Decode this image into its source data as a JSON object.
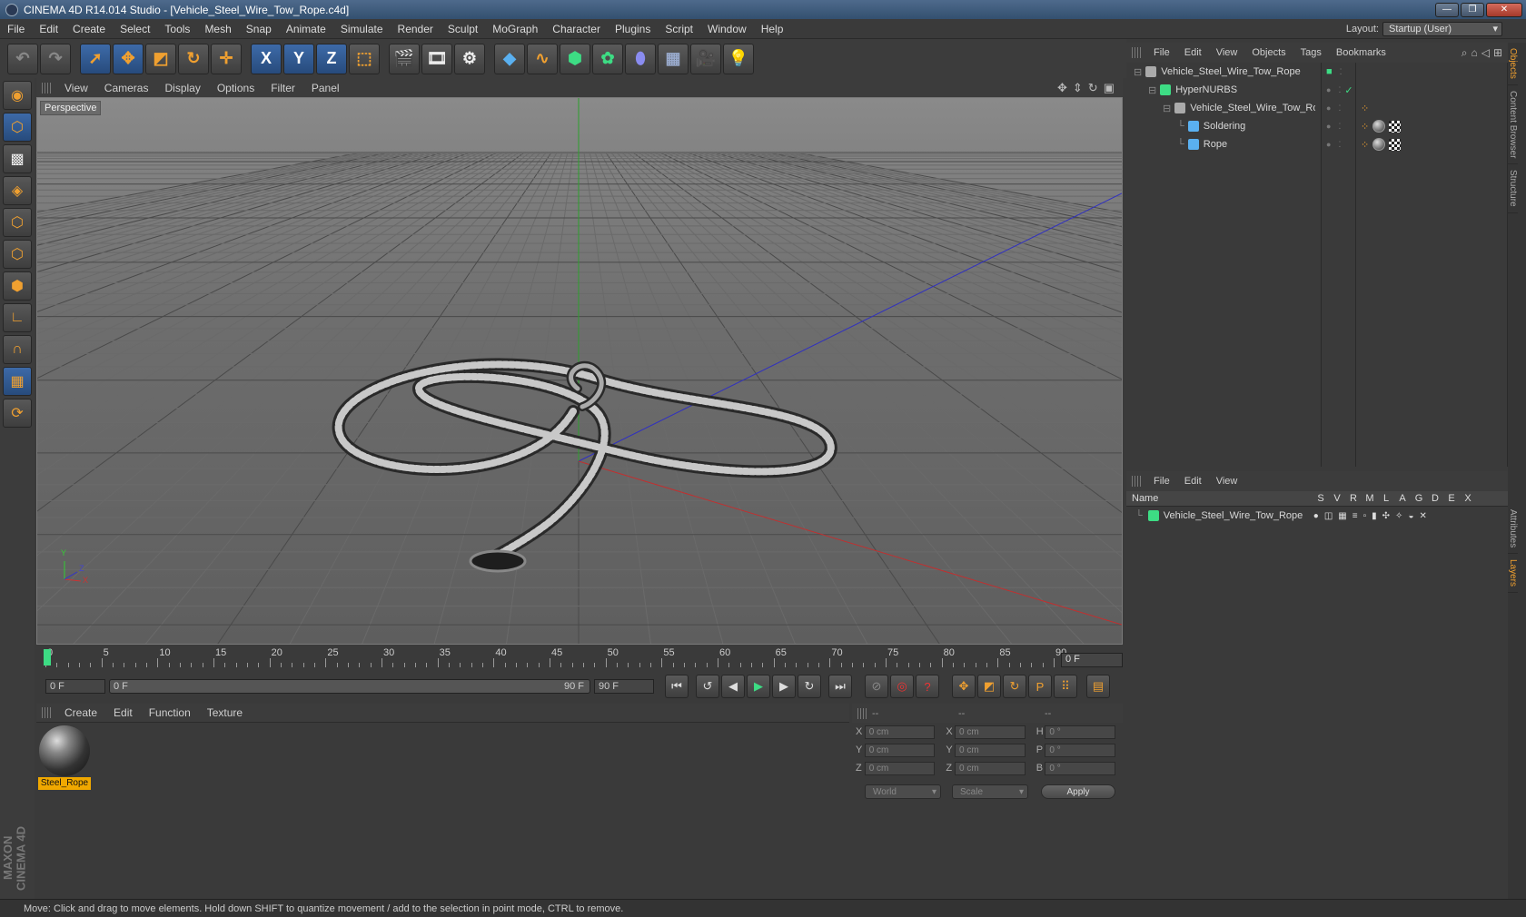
{
  "window": {
    "title": "CINEMA 4D R14.014 Studio - [Vehicle_Steel_Wire_Tow_Rope.c4d]",
    "min": "—",
    "max": "❐",
    "close": "✕"
  },
  "menubar": {
    "items": [
      "File",
      "Edit",
      "Create",
      "Select",
      "Tools",
      "Mesh",
      "Snap",
      "Animate",
      "Simulate",
      "Render",
      "Sculpt",
      "MoGraph",
      "Character",
      "Plugins",
      "Script",
      "Window",
      "Help"
    ],
    "layout_label": "Layout:",
    "layout_value": "Startup (User)"
  },
  "toolbar": {
    "icons": [
      "undo-icon",
      "redo-icon",
      "live-selection-icon",
      "move-icon",
      "scale-icon",
      "rotate-icon",
      "add-icon",
      "x-axis-icon",
      "y-axis-icon",
      "z-axis-icon",
      "coordinate-system-icon",
      "render-view-icon",
      "render-picture-icon",
      "render-settings-icon",
      "cube-icon",
      "spline-icon",
      "nurbs-icon",
      "array-icon",
      "deformer-icon",
      "floor-icon",
      "camera-icon",
      "light-icon"
    ],
    "axis_x": "X",
    "axis_y": "Y",
    "axis_z": "Z"
  },
  "viewport": {
    "menu": [
      "View",
      "Cameras",
      "Display",
      "Options",
      "Filter",
      "Panel"
    ],
    "label": "Perspective",
    "axis_x": "X",
    "axis_y": "Y",
    "axis_z": "Z"
  },
  "timeline": {
    "ticks": [
      "0",
      "5",
      "10",
      "15",
      "20",
      "25",
      "30",
      "35",
      "40",
      "45",
      "50",
      "55",
      "60",
      "65",
      "70",
      "75",
      "80",
      "85",
      "90"
    ],
    "current_frame": "0 F",
    "start_field": "0 F",
    "range_start": "0 F",
    "range_end": "90 F",
    "end_field": "90 F"
  },
  "materials": {
    "menu": [
      "Create",
      "Edit",
      "Function",
      "Texture"
    ],
    "items": [
      {
        "name": "Steel_Rope"
      }
    ]
  },
  "coordinates": {
    "header": [
      "--",
      "--",
      "--"
    ],
    "rows": [
      {
        "l1": "X",
        "v1": "0 cm",
        "l2": "X",
        "v2": "0 cm",
        "l3": "H",
        "v3": "0 °"
      },
      {
        "l1": "Y",
        "v1": "0 cm",
        "l2": "Y",
        "v2": "0 cm",
        "l3": "P",
        "v3": "0 °"
      },
      {
        "l1": "Z",
        "v1": "0 cm",
        "l2": "Z",
        "v2": "0 cm",
        "l3": "B",
        "v3": "0 °"
      }
    ],
    "mode": "World",
    "mode2": "Scale",
    "apply": "Apply"
  },
  "object_manager": {
    "menu": [
      "File",
      "Edit",
      "View",
      "Objects",
      "Tags",
      "Bookmarks"
    ],
    "objects": [
      {
        "name": "Vehicle_Steel_Wire_Tow_Rope",
        "indent": 0
      },
      {
        "name": "HyperNURBS",
        "indent": 1
      },
      {
        "name": "Vehicle_Steel_Wire_Tow_Rope",
        "indent": 2
      },
      {
        "name": "Soldering",
        "indent": 3
      },
      {
        "name": "Rope",
        "indent": 3
      }
    ]
  },
  "layer_manager": {
    "menu": [
      "File",
      "Edit",
      "View"
    ],
    "columns": [
      "Name",
      "S",
      "V",
      "R",
      "M",
      "L",
      "A",
      "G",
      "D",
      "E",
      "X"
    ],
    "layers": [
      {
        "name": "Vehicle_Steel_Wire_Tow_Rope",
        "color": "#3ddc84"
      }
    ]
  },
  "right_tabs": [
    "Objects",
    "Content Browser",
    "Structure",
    "Attributes",
    "Layers"
  ],
  "status": "Move: Click and drag to move elements. Hold down SHIFT to quantize movement / add to the selection in point mode, CTRL to remove.",
  "colors": {
    "accent": "#f0a030",
    "layer_green": "#3ddc84"
  }
}
